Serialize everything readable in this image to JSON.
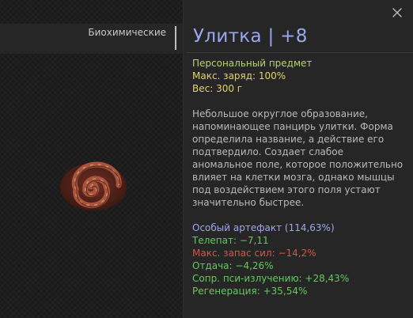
{
  "category": {
    "label": "Биохимические"
  },
  "item": {
    "title": "Улитка | +8",
    "type": "Персональный предмет",
    "charge": "Макс. заряд: 100%",
    "weight": "Вес: 300 г",
    "description": "Небольшое округлое образование, напоминающее панцирь улитки. Форма определила название, а действие его подтвердило. Создает слабое аномальное поле, которое положительно влияет на клетки мозга, однако мышцы под воздействием этого поля устают значительно быстрее.",
    "image_icon": "spiral-artifact-icon"
  },
  "stats": [
    {
      "text": "Особый артефакт (114,63%)",
      "kind": "special"
    },
    {
      "text": "Телепат: −7,11",
      "kind": "positive"
    },
    {
      "text": "Макс. запас сил: −14,2%",
      "kind": "negative"
    },
    {
      "text": "Отдача: −4,26%",
      "kind": "positive"
    },
    {
      "text": "Сопр. пси-излучению: +28,43%",
      "kind": "positive"
    },
    {
      "text": "Регенерация: +35,54%",
      "kind": "positive"
    }
  ],
  "colors": {
    "title": "#9aa6ee",
    "positive": "#63c95e",
    "negative": "#d9524a",
    "special": "#9ea7f0",
    "property_green": "#b4d66c",
    "property_yellow": "#e4d463"
  },
  "close_icon": "close-icon"
}
